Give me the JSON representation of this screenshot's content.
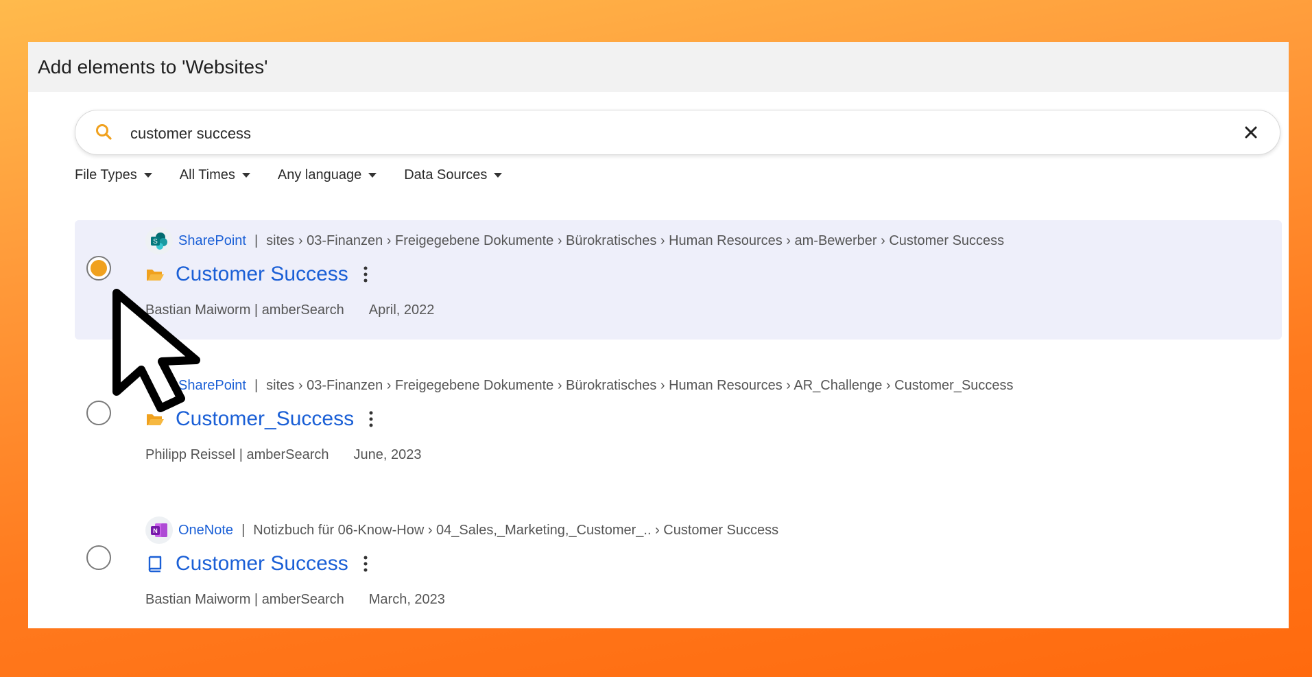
{
  "header": {
    "title": "Add elements to 'Websites'"
  },
  "search": {
    "value": "customer success",
    "placeholder": ""
  },
  "filters": [
    {
      "label": "File Types"
    },
    {
      "label": "All Times"
    },
    {
      "label": "Any language"
    },
    {
      "label": "Data Sources"
    }
  ],
  "results": [
    {
      "source": "SharePoint",
      "source_icon": "sharepoint-icon",
      "path": "sites › 03-Finanzen › Freigegebene Dokumente › Bürokratisches › Human Resources › am-Bewerber › Customer Success",
      "item_icon": "folder-open-icon",
      "title": "Customer Success",
      "author": "Bastian Maiworm | amberSearch",
      "date": "April, 2022",
      "selected": true
    },
    {
      "source": "SharePoint",
      "source_icon": "sharepoint-icon",
      "path": "sites › 03-Finanzen › Freigegebene Dokumente › Bürokratisches › Human Resources › AR_Challenge › Customer_Success",
      "item_icon": "folder-open-icon",
      "title": "Customer_Success",
      "author": "Philipp Reissel | amberSearch",
      "date": "June, 2023",
      "selected": false
    },
    {
      "source": "OneNote",
      "source_icon": "onenote-icon",
      "path": "Notizbuch für 06-Know-How › 04_Sales,_Marketing,_Customer_.. › Customer Success",
      "item_icon": "notebook-icon",
      "title": "Customer Success",
      "author": "Bastian Maiworm | amberSearch",
      "date": "March, 2023",
      "selected": false
    }
  ],
  "colors": {
    "accent": "#f0a11e",
    "link": "#1a5fd6",
    "selected_row": "#eeeffa",
    "sharepoint": "#038387",
    "onenote": "#7719aa"
  }
}
